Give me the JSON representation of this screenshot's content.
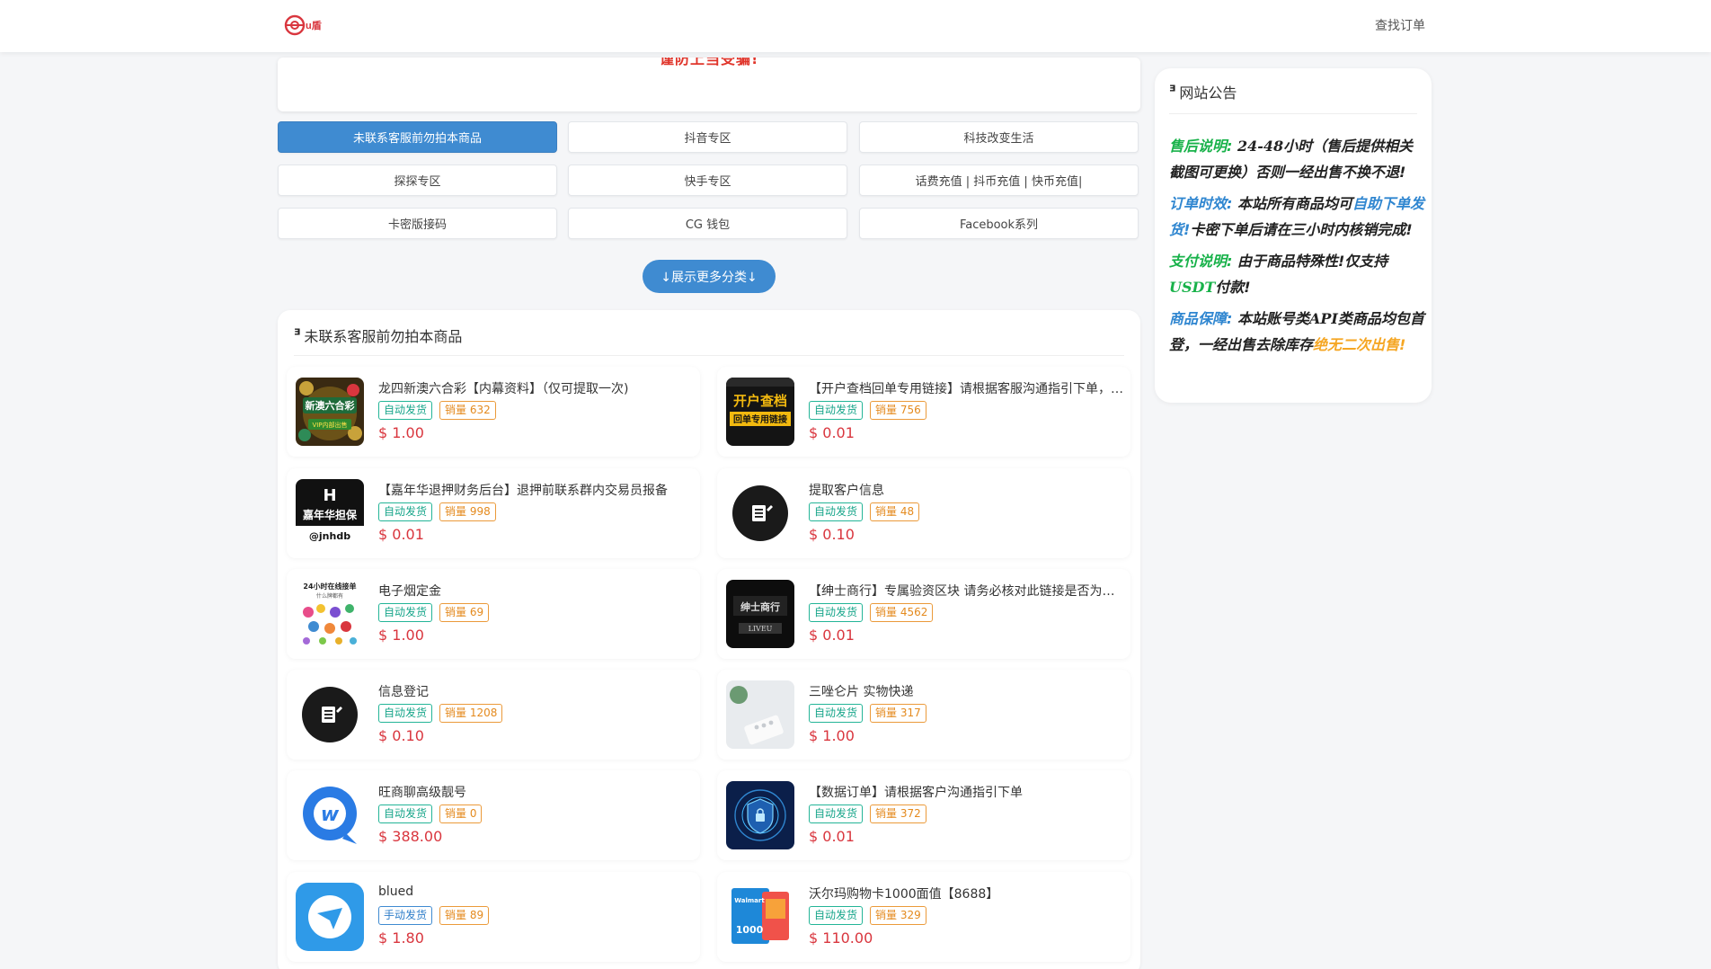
{
  "header": {
    "find_order": "查找订单",
    "logo_text": "u盾"
  },
  "banner": {
    "text": "谨防上当受骗!"
  },
  "categories": [
    {
      "label": "未联系客服前勿拍本商品",
      "active": true
    },
    {
      "label": "抖音专区"
    },
    {
      "label": "科技改变生活"
    },
    {
      "label": "探探专区"
    },
    {
      "label": "快手专区"
    },
    {
      "label": "话费充值 | 抖币充值 | 快币充值|"
    },
    {
      "label": "卡密版接码"
    },
    {
      "label": "CG 钱包"
    },
    {
      "label": "Facebook系列"
    }
  ],
  "more_button": "↓展示更多分类↓",
  "section": {
    "icon": "ᴲ",
    "title": "未联系客服前勿拍本商品"
  },
  "products": [
    {
      "name": "龙四新澳六合彩【内幕资料】（仅可提取一次)",
      "tag1": "自动发货",
      "sales": "销量 632",
      "price": "$ 1.00",
      "thumb_icon": "lottery-thumb-icon",
      "thumb_text": "新澳六合彩",
      "thumb_sub": "VIP内部出售"
    },
    {
      "name": "【开户查档回单专用链接】请根据客服沟通指引下单，请勿乱拍",
      "tag1": "自动发货",
      "sales": "销量 756",
      "price": "$ 0.01",
      "thumb_icon": "account-query-thumb-icon",
      "thumb_text": "开户查档",
      "thumb_sub": "回单专用链接"
    },
    {
      "name": "【嘉年华退押财务后台】退押前联系群内交易员报备",
      "tag1": "自动发货",
      "sales": "销量 998",
      "price": "$ 0.01",
      "thumb_icon": "carnival-guarantee-thumb-icon",
      "thumb_text": "嘉年华担保",
      "thumb_sub": "@jnhdb"
    },
    {
      "name": "提取客户信息",
      "tag1": "自动发货",
      "sales": "销量 48",
      "price": "$ 0.10",
      "thumb_icon": "note-edit-icon"
    },
    {
      "name": "电子烟定金",
      "tag1": "自动发货",
      "sales": "销量 69",
      "price": "$ 1.00",
      "thumb_icon": "ecig-thumb-icon",
      "thumb_text": "24小时在线接单",
      "thumb_sub": "什么牌都有"
    },
    {
      "name": "【绅士商行】专属验资区块 请务必核对此链接是否为客服发送",
      "tag1": "自动发货",
      "sales": "销量 4562",
      "price": "$ 0.01",
      "thumb_icon": "gentleman-store-thumb-icon",
      "thumb_text": "绅士商行"
    },
    {
      "name": "信息登记",
      "tag1": "自动发货",
      "sales": "销量 1208",
      "price": "$ 0.10",
      "thumb_icon": "note-edit-icon"
    },
    {
      "name": "三唑仑片 实物快递",
      "tag1": "自动发货",
      "sales": "销量 317",
      "price": "$ 1.00",
      "thumb_icon": "pills-thumb-icon"
    },
    {
      "name": "旺商聊高级靓号",
      "tag1": "自动发货",
      "sales": "销量 0",
      "price": "$ 388.00",
      "thumb_icon": "chat-app-thumb-icon"
    },
    {
      "name": "【数据订单】请根据客户沟通指引下单",
      "tag1": "自动发货",
      "sales": "销量 372",
      "price": "$ 0.01",
      "thumb_icon": "shield-data-thumb-icon"
    },
    {
      "name": "blued",
      "tag1": "手动发货",
      "sales": "销量 89",
      "price": "$ 1.80",
      "thumb_icon": "blued-app-thumb-icon"
    },
    {
      "name": "沃尔玛购物卡1000面值【8688】",
      "tag1": "自动发货",
      "sales": "销量 329",
      "price": "$ 110.00",
      "thumb_icon": "walmart-card-thumb-icon",
      "thumb_text": "1000"
    }
  ],
  "notice": {
    "title": "网站公告",
    "p1_label": "售后说明:",
    "p1_num": " 24-48",
    "p1_rest": "小时（售后提供相关截图可更换）否则一经出售不换不退!",
    "p2_label": "订单时效:",
    "p2_a": " 本站所有商品均可",
    "p2_link": "自助下单发货!",
    "p2_b": "卡密下单后请在三小时内核销完成!",
    "p3_label": "支付说明:",
    "p3_a": " 由于商品特殊性!仅支持",
    "p3_usdt": "USDT",
    "p3_b": "付款!",
    "p4_label": "商品保障:",
    "p4_a": " 本站账号类",
    "p4_api": "API",
    "p4_b": "类商品均包首登，一经出售去除库存",
    "p4_end": "绝无二次出售!"
  },
  "colors": {
    "accent": "#3f8bd1",
    "price": "#d9363e",
    "green_tag": "#17a58a",
    "orange_tag": "#e48a1e",
    "notice_green": "#18b24a",
    "notice_blue": "#2f86d0",
    "notice_orange": "#f5a623"
  }
}
